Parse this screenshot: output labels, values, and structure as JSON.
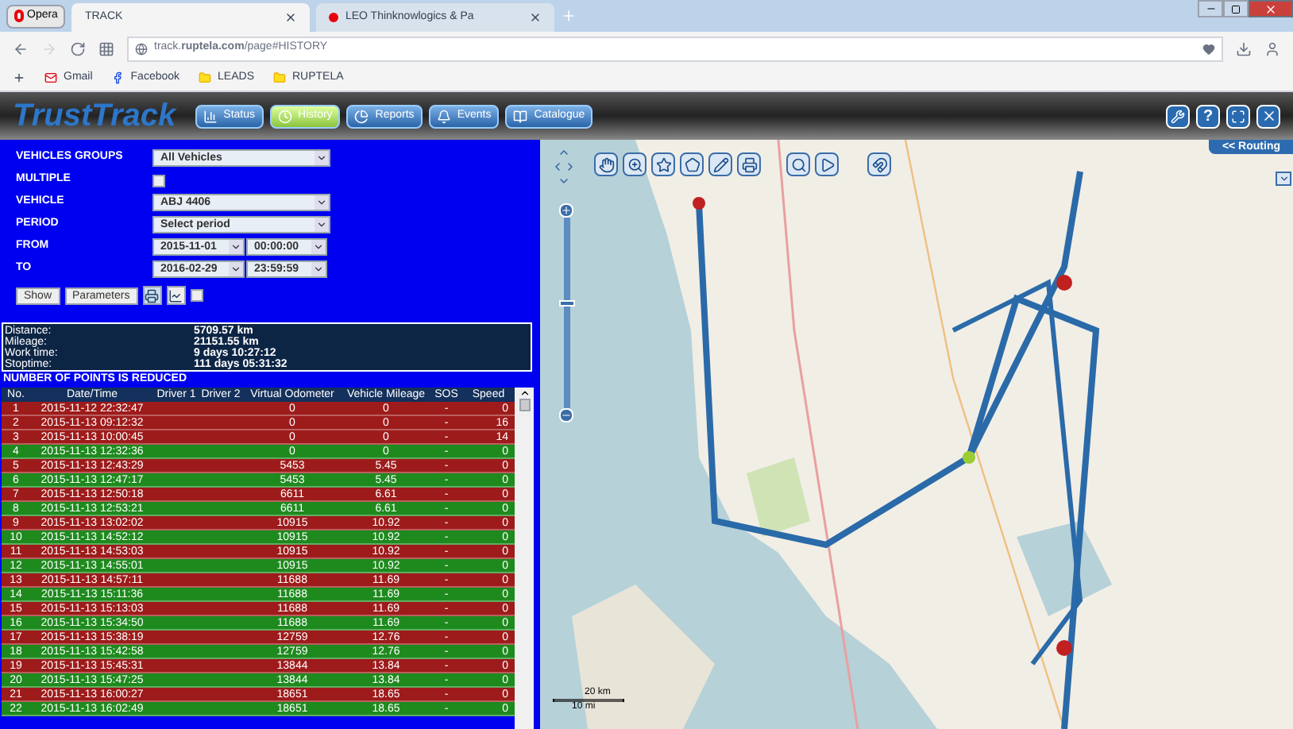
{
  "browser": {
    "menu_button": "Opera",
    "tabs": [
      {
        "label": "TRACK",
        "selected": true
      },
      {
        "label": "LEO Thinknowlogics & Pa",
        "selected": false
      }
    ],
    "address": "track.**ruptela.com**/page#HISTORY",
    "bookmarks": [
      "Gmail",
      "Facebook",
      "LEADS",
      "RUPTELA"
    ]
  },
  "app": {
    "logo": "TrustTrack",
    "nav": [
      {
        "label": "Status",
        "selected": false
      },
      {
        "label": "History",
        "selected": true
      },
      {
        "label": "Reports",
        "selected": false
      },
      {
        "label": "Events",
        "selected": false
      },
      {
        "label": "Catalogue",
        "selected": false
      }
    ],
    "help": "?"
  },
  "form": {
    "groups_label": "VEHICLES GROUPS",
    "groups_value": "All Vehicles",
    "multiple_label": "MULTIPLE",
    "multiple_checked": false,
    "vehicle_label": "VEHICLE",
    "vehicle_value": "ABJ 4406",
    "period_label": "PERIOD",
    "period_value": "Select period",
    "from_label": "FROM",
    "from_date": "2015-11-01",
    "from_time": "00:00:00",
    "to_label": "TO",
    "to_date": "2016-02-29",
    "to_time": "23:59:59",
    "buttons": [
      "Show",
      "Parameters"
    ],
    "extra_checked": false
  },
  "stats": [
    {
      "label": "Distance:",
      "value": "5709.57 km"
    },
    {
      "label": "Mileage:",
      "value": "21151.55 km"
    },
    {
      "label": "Work time:",
      "value": "9 days 10:27:12"
    },
    {
      "label": "Stoptime:",
      "value": "111 days 05:31:32"
    }
  ],
  "notice": "NUMBER OF POINTS IS REDUCED",
  "table": {
    "columns": [
      "No.",
      "Date/Time",
      "Driver 1",
      "Driver 2",
      "Virtual Odometer",
      "Vehicle Mileage",
      "SOS",
      "Speed"
    ],
    "rows": [
      {
        "no": "1",
        "datetime": "2015-11-12 22:32:47",
        "odometer": "0",
        "mileage": "0",
        "sos": "-",
        "speed": "0",
        "color": "#9e1b1b"
      },
      {
        "no": "2",
        "datetime": "2015-11-13 09:12:32",
        "odometer": "0",
        "mileage": "0",
        "sos": "-",
        "speed": "16",
        "color": "#9e1b1b"
      },
      {
        "no": "3",
        "datetime": "2015-11-13 10:00:45",
        "odometer": "0",
        "mileage": "0",
        "sos": "-",
        "speed": "14",
        "color": "#9e1b1b"
      },
      {
        "no": "4",
        "datetime": "2015-11-13 12:32:36",
        "odometer": "0",
        "mileage": "0",
        "sos": "-",
        "speed": "0",
        "color": "#1e8a1e"
      },
      {
        "no": "5",
        "datetime": "2015-11-13 12:43:29",
        "odometer": "5453",
        "mileage": "5.45",
        "sos": "-",
        "speed": "0",
        "color": "#9e1b1b"
      },
      {
        "no": "6",
        "datetime": "2015-11-13 12:47:17",
        "odometer": "5453",
        "mileage": "5.45",
        "sos": "-",
        "speed": "0",
        "color": "#1e8a1e"
      },
      {
        "no": "7",
        "datetime": "2015-11-13 12:50:18",
        "odometer": "6611",
        "mileage": "6.61",
        "sos": "-",
        "speed": "0",
        "color": "#9e1b1b"
      },
      {
        "no": "8",
        "datetime": "2015-11-13 12:53:21",
        "odometer": "6611",
        "mileage": "6.61",
        "sos": "-",
        "speed": "0",
        "color": "#1e8a1e"
      },
      {
        "no": "9",
        "datetime": "2015-11-13 13:02:02",
        "odometer": "10915",
        "mileage": "10.92",
        "sos": "-",
        "speed": "0",
        "color": "#9e1b1b"
      },
      {
        "no": "10",
        "datetime": "2015-11-13 14:52:12",
        "odometer": "10915",
        "mileage": "10.92",
        "sos": "-",
        "speed": "0",
        "color": "#1e8a1e"
      },
      {
        "no": "11",
        "datetime": "2015-11-13 14:53:03",
        "odometer": "10915",
        "mileage": "10.92",
        "sos": "-",
        "speed": "0",
        "color": "#9e1b1b"
      },
      {
        "no": "12",
        "datetime": "2015-11-13 14:55:01",
        "odometer": "10915",
        "mileage": "10.92",
        "sos": "-",
        "speed": "0",
        "color": "#1e8a1e"
      },
      {
        "no": "13",
        "datetime": "2015-11-13 14:57:11",
        "odometer": "11688",
        "mileage": "11.69",
        "sos": "-",
        "speed": "0",
        "color": "#9e1b1b"
      },
      {
        "no": "14",
        "datetime": "2015-11-13 15:11:36",
        "odometer": "11688",
        "mileage": "11.69",
        "sos": "-",
        "speed": "0",
        "color": "#1e8a1e"
      },
      {
        "no": "15",
        "datetime": "2015-11-13 15:13:03",
        "odometer": "11688",
        "mileage": "11.69",
        "sos": "-",
        "speed": "0",
        "color": "#9e1b1b"
      },
      {
        "no": "16",
        "datetime": "2015-11-13 15:34:50",
        "odometer": "11688",
        "mileage": "11.69",
        "sos": "-",
        "speed": "0",
        "color": "#1e8a1e"
      },
      {
        "no": "17",
        "datetime": "2015-11-13 15:38:19",
        "odometer": "12759",
        "mileage": "12.76",
        "sos": "-",
        "speed": "0",
        "color": "#9e1b1b"
      },
      {
        "no": "18",
        "datetime": "2015-11-13 15:42:58",
        "odometer": "12759",
        "mileage": "12.76",
        "sos": "-",
        "speed": "0",
        "color": "#1e8a1e"
      },
      {
        "no": "19",
        "datetime": "2015-11-13 15:45:31",
        "odometer": "13844",
        "mileage": "13.84",
        "sos": "-",
        "speed": "0",
        "color": "#9e1b1b"
      },
      {
        "no": "20",
        "datetime": "2015-11-13 15:47:25",
        "odometer": "13844",
        "mileage": "13.84",
        "sos": "-",
        "speed": "0",
        "color": "#1e8a1e"
      },
      {
        "no": "21",
        "datetime": "2015-11-13 16:00:27",
        "odometer": "18651",
        "mileage": "18.65",
        "sos": "-",
        "speed": "0",
        "color": "#9e1b1b"
      },
      {
        "no": "22",
        "datetime": "2015-11-13 16:02:49",
        "odometer": "18651",
        "mileage": "18.65",
        "sos": "-",
        "speed": "0",
        "color": "#1e8a1e"
      }
    ]
  },
  "map": {
    "zoom_slider": {
      "level": 0.55
    },
    "routing_button": "<< Routing",
    "scale_km": "20 km",
    "scale_mi": "10 mi"
  }
}
